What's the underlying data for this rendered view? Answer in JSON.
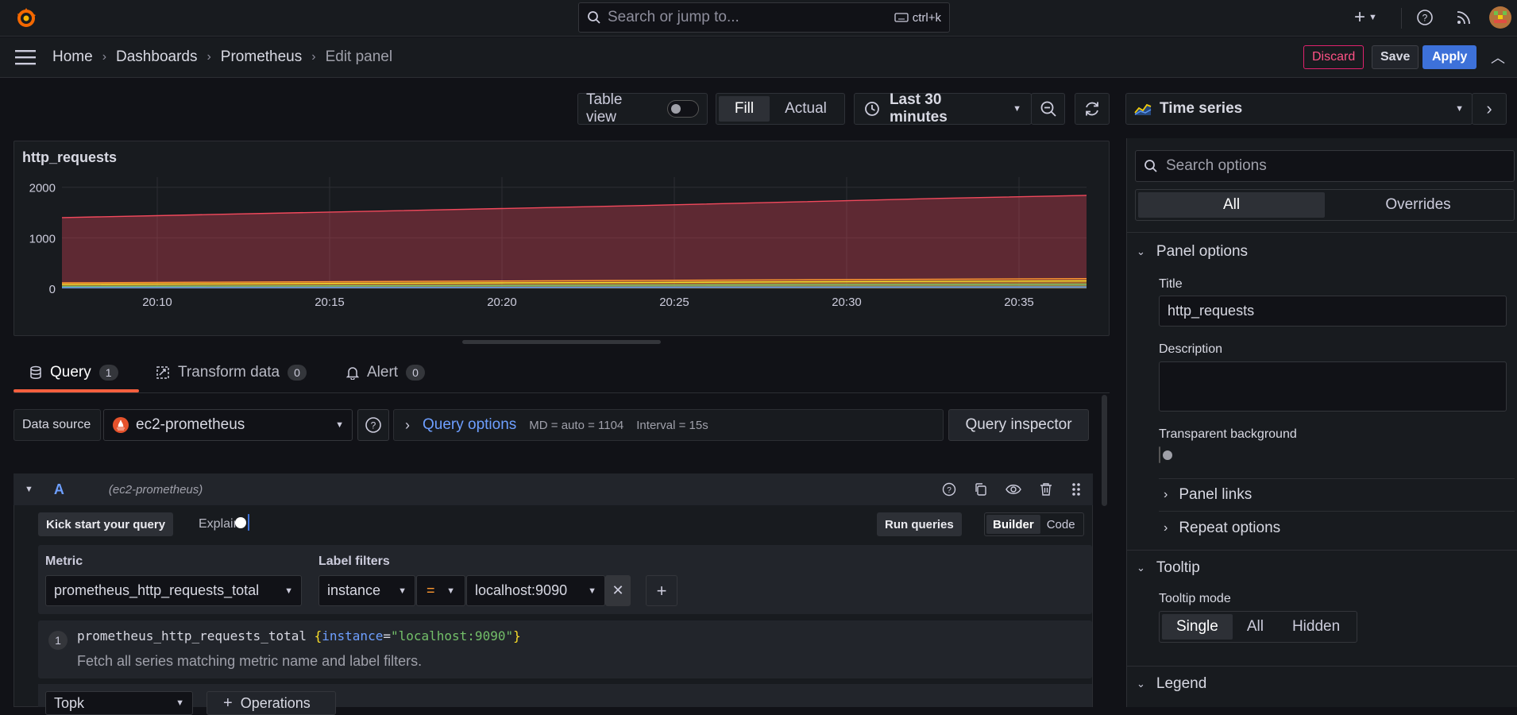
{
  "topbar": {
    "search_placeholder": "Search or jump to...",
    "search_shortcut": "ctrl+k"
  },
  "breadcrumb": {
    "items": [
      "Home",
      "Dashboards",
      "Prometheus"
    ],
    "current": "Edit panel"
  },
  "actions": {
    "discard": "Discard",
    "save": "Save",
    "apply": "Apply"
  },
  "toolbar": {
    "table_view": "Table view",
    "fill": "Fill",
    "actual": "Actual",
    "time_range": "Last 30 minutes",
    "visualization": "Time series"
  },
  "panel": {
    "title": "http_requests"
  },
  "chart_data": {
    "type": "area",
    "y_ticks": [
      "2000",
      "1000",
      "0"
    ],
    "x_ticks": [
      "20:10",
      "20:15",
      "20:20",
      "20:25",
      "20:30",
      "20:35"
    ],
    "ylim": [
      0,
      2200
    ],
    "series": [
      {
        "color": "#f2495c",
        "values": [
          1400,
          1460,
          1520,
          1580,
          1640,
          1710,
          1780,
          1840
        ]
      },
      {
        "color": "#ff9830",
        "values": [
          110,
          122,
          134,
          146,
          158,
          170,
          182,
          194
        ]
      },
      {
        "color": "#fade2a",
        "values": [
          80,
          90,
          100,
          110,
          120,
          130,
          140,
          150
        ]
      },
      {
        "color": "#73bf69",
        "values": [
          40,
          46,
          52,
          58,
          64,
          70,
          76,
          82
        ]
      },
      {
        "color": "#5794f2",
        "values": [
          15,
          17,
          19,
          21,
          23,
          25,
          27,
          29
        ]
      }
    ]
  },
  "tabs": [
    {
      "label": "Query",
      "count": "1"
    },
    {
      "label": "Transform data",
      "count": "0"
    },
    {
      "label": "Alert",
      "count": "0"
    }
  ],
  "datasource": {
    "label": "Data source",
    "value": "ec2-prometheus",
    "query_options": "Query options",
    "md": "MD = auto = 1104",
    "interval": "Interval = 15s",
    "inspector": "Query inspector"
  },
  "query": {
    "ref": "A",
    "source": "(ec2-prometheus)",
    "kick_start": "Kick start your query",
    "explain": "Explain",
    "run": "Run queries",
    "builder": "Builder",
    "code": "Code",
    "metric_label": "Metric",
    "metric_value": "prometheus_http_requests_total",
    "label_filters": "Label filters",
    "filter_label": "instance",
    "filter_op": "=",
    "filter_value": "localhost:9090",
    "line_no": "1",
    "expr_metric": "prometheus_http_requests_total",
    "expr_open": "{",
    "expr_key": "instance",
    "expr_eq": "=",
    "expr_val": "\"localhost:9090\"",
    "expr_close": "}",
    "explain_text": "Fetch all series matching metric name and label filters.",
    "op_select": "Topk",
    "operations": "Operations"
  },
  "sidebar": {
    "search_placeholder": "Search options",
    "all": "All",
    "overrides": "Overrides",
    "panel_options": "Panel options",
    "title_label": "Title",
    "title_value": "http_requests",
    "description_label": "Description",
    "transparent_label": "Transparent background",
    "panel_links": "Panel links",
    "repeat_options": "Repeat options",
    "tooltip": "Tooltip",
    "tooltip_mode": "Tooltip mode",
    "mode_single": "Single",
    "mode_all": "All",
    "mode_hidden": "Hidden",
    "legend": "Legend"
  }
}
